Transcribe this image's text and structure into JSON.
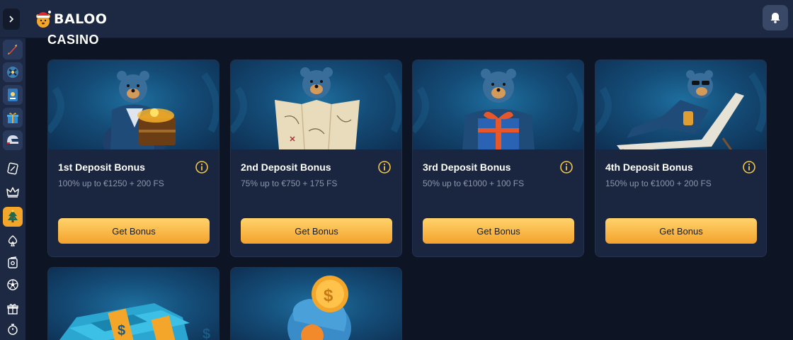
{
  "header": {
    "logo_text": "BALOO",
    "toggle_icon": "chevron-right-icon",
    "bell_icon": "bell-icon"
  },
  "sidebar": {
    "items": [
      {
        "icon": "rocket-icon"
      },
      {
        "icon": "aviator-icon"
      },
      {
        "icon": "slot-card-icon"
      },
      {
        "icon": "gift-icon"
      },
      {
        "icon": "helmet-icon"
      },
      {
        "icon": "sports-betting-icon"
      },
      {
        "icon": "crown-icon"
      },
      {
        "icon": "christmas-tree-icon",
        "active": true
      },
      {
        "icon": "spade-icon"
      },
      {
        "icon": "cards-icon"
      },
      {
        "icon": "football-icon"
      },
      {
        "icon": "gift-box-icon"
      },
      {
        "icon": "stopwatch-icon"
      }
    ]
  },
  "main": {
    "section_title": "CASINO",
    "cards": [
      {
        "title": "1st Deposit Bonus",
        "subtitle": "100% up to €1250 + 200 FS",
        "button": "Get Bonus",
        "image": "bear-treasure-chest"
      },
      {
        "title": "2nd Deposit Bonus",
        "subtitle": "75% up to €750 + 175 FS",
        "button": "Get Bonus",
        "image": "bear-map"
      },
      {
        "title": "3rd Deposit Bonus",
        "subtitle": "50% up to €1000 + 100 FS",
        "button": "Get Bonus",
        "image": "bear-gift"
      },
      {
        "title": "4th Deposit Bonus",
        "subtitle": "150% up to €1000 + 200 FS",
        "button": "Get Bonus",
        "image": "bear-lounger"
      }
    ],
    "partial_cards": [
      {
        "image": "money-stacks"
      },
      {
        "image": "gold-coins"
      }
    ]
  },
  "colors": {
    "accent": "#f4a62a",
    "header_bg": "#1d2942",
    "page_bg": "#0d1424",
    "card_bg": "#1a2640"
  }
}
